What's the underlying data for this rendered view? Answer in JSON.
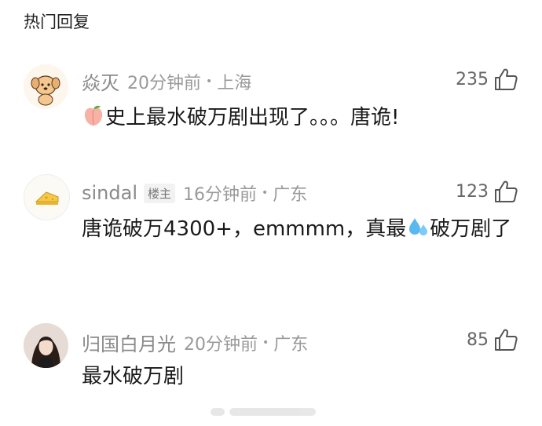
{
  "header": {
    "title": "热门回复"
  },
  "comments": [
    {
      "username": "焱灭",
      "badge": "",
      "time": "20分钟前",
      "location": "上海",
      "likes": "235",
      "content_pre": "",
      "content_mid": "史上最水破万剧出现了。。。唐诡!",
      "content_post": "",
      "avatar_icon": "cartoon-dog-avatar",
      "emoji": "peach-icon"
    },
    {
      "username": "sindal",
      "badge": "楼主",
      "time": "16分钟前",
      "location": "广东",
      "likes": "123",
      "content_pre": "唐诡破万4300+，emmmm，真最",
      "content_post": "破万剧了",
      "avatar_icon": "cheese-avatar",
      "emoji": "sweat-droplets-icon"
    },
    {
      "username": "归国白月光",
      "badge": "",
      "time": "20分钟前",
      "location": "广东",
      "likes": "85",
      "content_pre": "最水破万剧",
      "content_post": "",
      "avatar_icon": "photo-avatar",
      "emoji": ""
    }
  ],
  "colors": {
    "meta": "#9a9a9a",
    "text": "#1a1a1a",
    "peach": "#f7b2a5"
  }
}
